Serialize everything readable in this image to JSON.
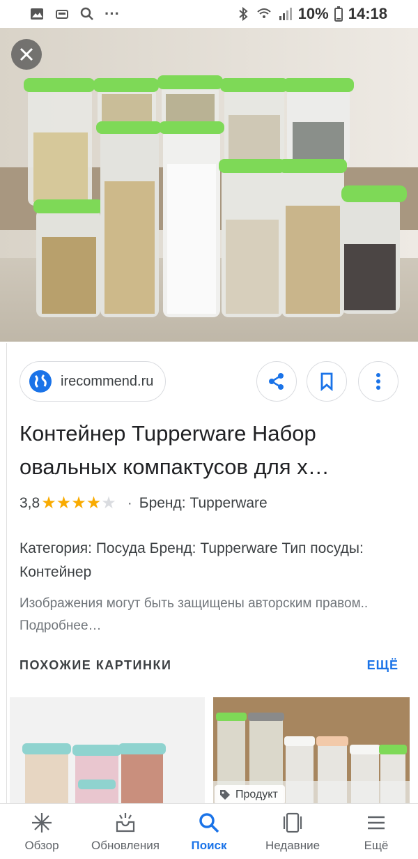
{
  "status_bar": {
    "battery": "10%",
    "time": "14:18",
    "more": "···"
  },
  "source": {
    "domain": "irecommend.ru"
  },
  "result": {
    "title": "Контейнер Tupperware Набор овальных компактусов для х…",
    "rating_value": "3,8",
    "rating_stars": 3.8,
    "separator": "·",
    "brand": "Бренд: Tupperware",
    "description": "Категория: Посуда Бренд: Tupperware Тип посуды: Контейнер",
    "copyright": "Изображения могут быть защищены авторским правом.. Подробнее…"
  },
  "similar": {
    "heading": "ПОХОЖИЕ КАРТИНКИ",
    "more_label": "ЕЩЁ",
    "badge": "Продукт"
  },
  "nav": [
    {
      "label": "Обзор",
      "icon": "sparkle-icon"
    },
    {
      "label": "Обновления",
      "icon": "inbox-updates-icon"
    },
    {
      "label": "Поиск",
      "icon": "search-icon",
      "active": true
    },
    {
      "label": "Недавние",
      "icon": "recent-cards-icon"
    },
    {
      "label": "Ещё",
      "icon": "menu-icon"
    }
  ],
  "colors": {
    "accent": "#1a73e8",
    "star": "#f9ab00",
    "lid_green": "#7ed957"
  }
}
